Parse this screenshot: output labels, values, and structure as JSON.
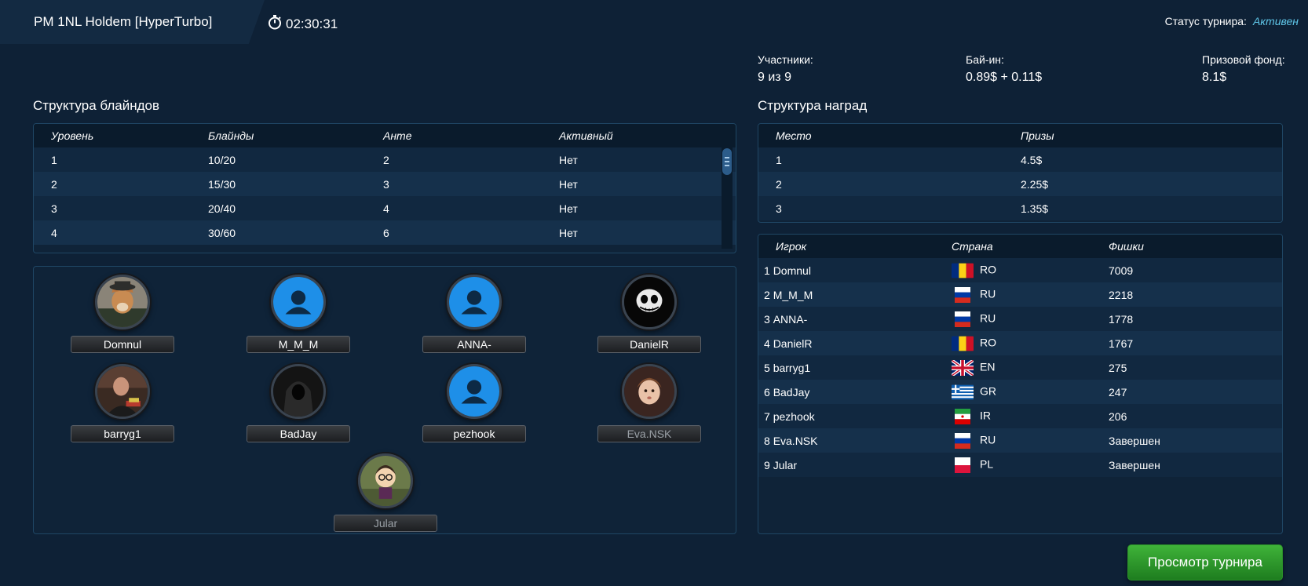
{
  "header": {
    "title": "PM 1NL Holdem [HyperTurbo]",
    "timer": "02:30:31",
    "status_label": "Статус турнира:",
    "status_value": "Активен"
  },
  "stats": {
    "participants_label": "Участники:",
    "participants_value": "9 из 9",
    "buyin_label": "Бай-ин:",
    "buyin_value": "0.89$ + 0.11$",
    "prize_label": "Призовой фонд:",
    "prize_value": "8.1$"
  },
  "blinds": {
    "title": "Структура блайндов",
    "columns": [
      "Уровень",
      "Блайнды",
      "Анте",
      "Активный"
    ],
    "rows": [
      [
        "1",
        "10/20",
        "2",
        "Нет"
      ],
      [
        "2",
        "15/30",
        "3",
        "Нет"
      ],
      [
        "3",
        "20/40",
        "4",
        "Нет"
      ],
      [
        "4",
        "30/60",
        "6",
        "Нет"
      ]
    ]
  },
  "prizes": {
    "title": "Структура наград",
    "columns": [
      "Место",
      "Призы"
    ],
    "rows": [
      [
        "1",
        "4.5$"
      ],
      [
        "2",
        "2.25$"
      ],
      [
        "3",
        "1.35$"
      ]
    ]
  },
  "players_table": {
    "columns": [
      "Игрок",
      "Страна",
      "Фишки"
    ],
    "rows": [
      {
        "rank": "1",
        "name": "Domnul",
        "country": "RO",
        "chips": "7009"
      },
      {
        "rank": "2",
        "name": "M_M_M",
        "country": "RU",
        "chips": "2218"
      },
      {
        "rank": "3",
        "name": "ANNA-",
        "country": "RU",
        "chips": "1778"
      },
      {
        "rank": "4",
        "name": "DanielR",
        "country": "RO",
        "chips": "1767"
      },
      {
        "rank": "5",
        "name": "barryg1",
        "country": "EN",
        "chips": "275"
      },
      {
        "rank": "6",
        "name": "BadJay",
        "country": "GR",
        "chips": "247"
      },
      {
        "rank": "7",
        "name": "pezhook",
        "country": "IR",
        "chips": "206"
      },
      {
        "rank": "8",
        "name": "Eva.NSK",
        "country": "RU",
        "chips": "Завершен"
      },
      {
        "rank": "9",
        "name": "Jular",
        "country": "PL",
        "chips": "Завершен"
      }
    ]
  },
  "seats": [
    {
      "name": "Domnul",
      "avatar": "dog-photo-avatar",
      "dim": false
    },
    {
      "name": "M_M_M",
      "avatar": "default-user-avatar",
      "dim": false
    },
    {
      "name": "ANNA-",
      "avatar": "default-user-avatar",
      "dim": false
    },
    {
      "name": "DanielR",
      "avatar": "skull-avatar",
      "dim": false
    },
    {
      "name": "barryg1",
      "avatar": "man-photo-avatar",
      "dim": false
    },
    {
      "name": "BadJay",
      "avatar": "hooded-figure-avatar",
      "dim": false
    },
    {
      "name": "pezhook",
      "avatar": "default-user-avatar",
      "dim": false
    },
    {
      "name": "Eva.NSK",
      "avatar": "child-photo-avatar",
      "dim": true
    },
    {
      "name": "Jular",
      "avatar": "cartoon-avatar",
      "dim": true
    }
  ],
  "view_button": "Просмотр турнира",
  "colors": {
    "background": "#0e2136",
    "accent_status": "#5fc6e8",
    "default_avatar": "#1e8fe8",
    "button_green": "#2e9a2c"
  }
}
